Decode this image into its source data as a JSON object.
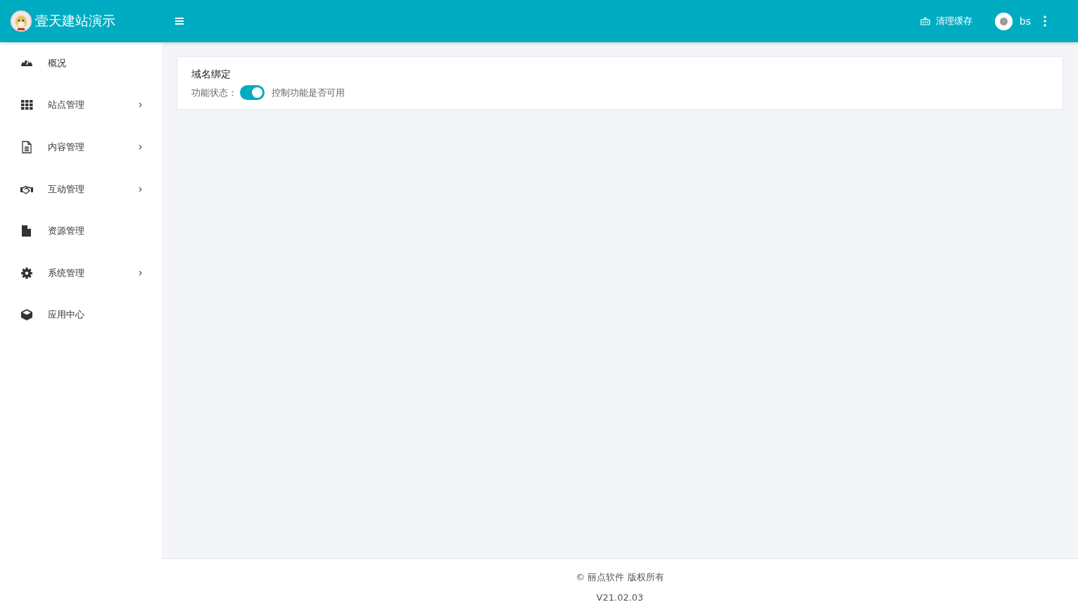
{
  "header": {
    "site_title": "壹天建站演示",
    "clear_cache": "清理缓存",
    "user": "bs"
  },
  "sidebar": {
    "items": [
      {
        "label": "概况",
        "kind": "dashboard",
        "expandable": false
      },
      {
        "label": "站点管理",
        "kind": "grid",
        "expandable": true
      },
      {
        "label": "内容管理",
        "kind": "document",
        "expandable": true
      },
      {
        "label": "互动管理",
        "kind": "handshake",
        "expandable": true
      },
      {
        "label": "资源管理",
        "kind": "file",
        "expandable": false
      },
      {
        "label": "系统管理",
        "kind": "gear",
        "expandable": true
      },
      {
        "label": "应用中心",
        "kind": "cube",
        "expandable": false
      }
    ]
  },
  "card": {
    "title": "域名绑定",
    "status_label": "功能状态：",
    "enabled": true,
    "hint": "控制功能是否可用"
  },
  "footer": {
    "copyright": "© 丽点软件 版权所有",
    "version": "V21.02.03"
  }
}
